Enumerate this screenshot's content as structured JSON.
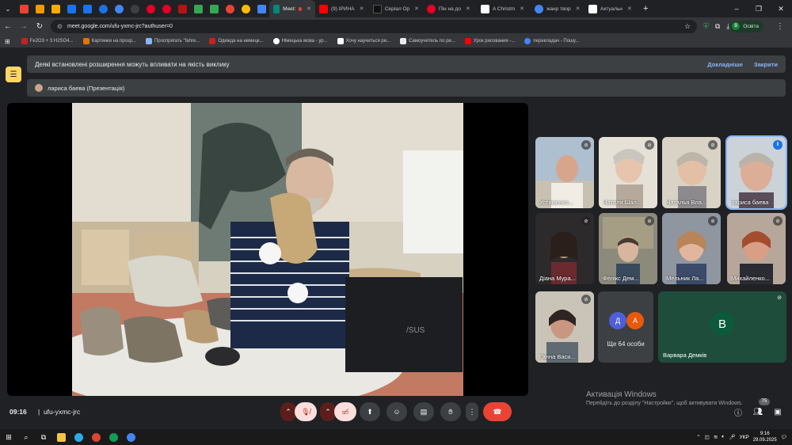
{
  "browser": {
    "tabs": [
      {
        "title": "Meet: ",
        "active": true
      },
      {
        "title": "(9) ІРИНА",
        "active": false
      },
      {
        "title": "Серіал Ор",
        "active": false
      },
      {
        "title": "Пін на до",
        "active": false
      },
      {
        "title": "A Christm",
        "active": false
      },
      {
        "title": "жанр твор",
        "active": false
      },
      {
        "title": "Актуальн",
        "active": false
      }
    ],
    "url": "meet.google.com/ufu-yxmc-jrc?authuser=0",
    "profile": {
      "initial": "В",
      "label": "Освіта"
    },
    "window_controls": [
      "–",
      "❐",
      "✕"
    ]
  },
  "bookmarks": [
    "Fe2O3 + 3 H2SO4...",
    "Картинки на прозр...",
    "Проспрягать \"fahre...",
    "Одежда на немецк...",
    "Німецька мова - ур...",
    "Хочу научиться ри...",
    "Самоучитель по ри...",
    "Урок рисования -...",
    "перекладач - Пошу..."
  ],
  "banner": {
    "text": "Деякі встановлені розширення можуть впливати на якість виклику",
    "details": "Докладніше",
    "close": "Закрити"
  },
  "presenter": {
    "label": "лариса баева (Презентація)"
  },
  "participants": [
    {
      "name": "Устименко...",
      "speaking": false
    },
    {
      "name": "Наталя Шал...",
      "speaking": false
    },
    {
      "name": "Наталья Вла...",
      "speaking": false
    },
    {
      "name": "лариса баева",
      "speaking": true
    },
    {
      "name": "Діана Мура...",
      "speaking": false
    },
    {
      "name": "Фелікс Дем...",
      "speaking": false
    },
    {
      "name": "Мельник Ла...",
      "speaking": false
    },
    {
      "name": "Михайленко...",
      "speaking": false
    },
    {
      "name": "Ганна Васи...",
      "speaking": false
    }
  ],
  "more": {
    "initials": [
      "Д",
      "А"
    ],
    "label": "Ще 64 особи"
  },
  "big_tile": {
    "initial": "В",
    "name": "Варвара Демків"
  },
  "activation": {
    "title": "Активація Windows",
    "subtitle": "Перейдіть до розділу \"Настройки\", щоб активувати Windows."
  },
  "meeting": {
    "time": "09:16",
    "code": "ufu-yxmc-jrc",
    "participant_count": "75"
  },
  "colors": {
    "end_call": "#ea4335",
    "accent": "#8ab4f8",
    "mic_off": "#f9dedc"
  },
  "taskbar": {
    "lang": "УКР",
    "time": "9:16",
    "date": "29.09.2025"
  }
}
